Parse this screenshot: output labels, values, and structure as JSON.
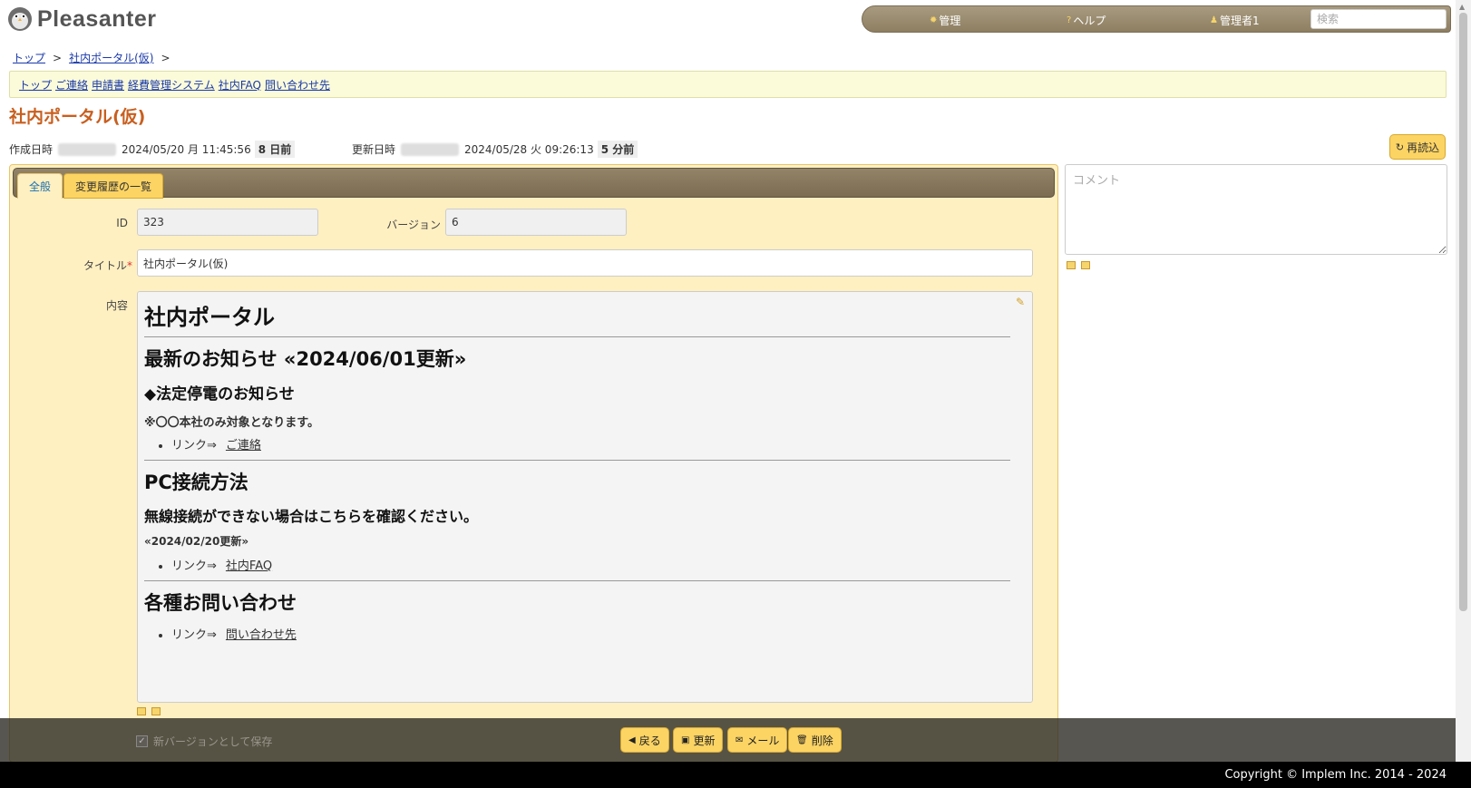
{
  "header": {
    "logo_text": "Pleasanter",
    "nav": {
      "admin": "管理",
      "help": "ヘルプ",
      "user": "管理者1"
    },
    "search_placeholder": "検索"
  },
  "breadcrumb": {
    "top": "トップ",
    "sep": ">",
    "current": "社内ポータル(仮)"
  },
  "linkbar": [
    "トップ",
    "ご連絡",
    "申請書",
    "経費管理システム",
    "社内FAQ",
    "問い合わせ先"
  ],
  "page_title": "社内ポータル(仮)",
  "meta": {
    "created_label": "作成日時",
    "created_at": "2024/05/20 月 11:45:56",
    "created_rel": "8 日前",
    "updated_label": "更新日時",
    "updated_at": "2024/05/28 火 09:26:13",
    "updated_rel": "5 分前"
  },
  "reload_label": "再読込",
  "tabs": {
    "general": "全般",
    "history": "変更履歴の一覧"
  },
  "form": {
    "id_label": "ID",
    "id_value": "323",
    "version_label": "バージョン",
    "version_value": "6",
    "title_label": "タイトル",
    "title_required": "*",
    "title_value": "社内ポータル(仮)",
    "content_label": "内容"
  },
  "content": {
    "h1": "社内ポータル",
    "news_heading": "最新のお知らせ «2024/06/01更新»",
    "outage_heading": "◆法定停電のお知らせ",
    "outage_note": "※〇〇本社のみ対象となります。",
    "link_prefix": "リンク⇒",
    "link1": "ご連絡",
    "pc_heading": "PC接続方法",
    "wireless_heading": "無線接続ができない場合はこちらを確認ください。",
    "wireless_date": "«2024/02/20更新»",
    "link2": "社内FAQ",
    "inquiry_heading": "各種お問い合わせ",
    "link3": "問い合わせ先"
  },
  "comment_placeholder": "コメント",
  "commands": {
    "save_new_version": "新バージョンとして保存",
    "back": "戻る",
    "update": "更新",
    "mail": "メール",
    "delete": "削除"
  },
  "footer": "Copyright © Implem Inc. 2014 - 2024"
}
